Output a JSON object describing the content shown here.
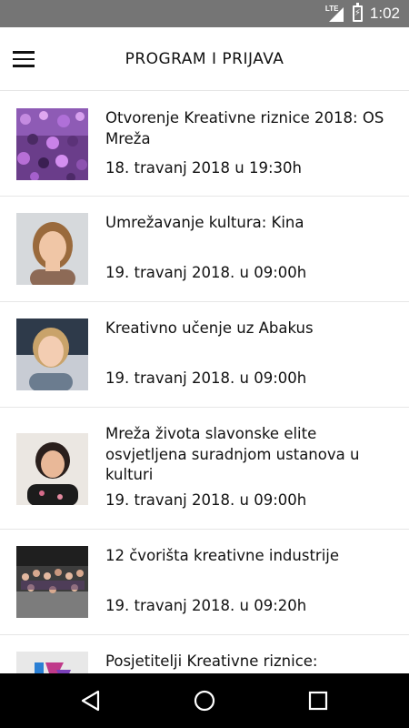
{
  "status_bar": {
    "network_label": "LTE",
    "time": "1:02",
    "icons": [
      "signal-icon",
      "battery-charging-icon"
    ]
  },
  "app_bar": {
    "title": "PROGRAM I PRIJAVA",
    "menu_icon": "hamburger-menu-icon"
  },
  "events": [
    {
      "title": "Otvorenje Kreativne riznice 2018: OS Mreža",
      "date": "18. travanj 2018 u 19:30h",
      "thumbnail": "crowd-purple-photo"
    },
    {
      "title": "Umrežavanje kultura: Kina",
      "date": "19. travanj 2018. u 09:00h",
      "thumbnail": "woman-portrait-photo"
    },
    {
      "title": "Kreativno učenje uz Abakus",
      "date": "19. travanj 2018. u 09:00h",
      "thumbnail": "blonde-woman-portrait-photo"
    },
    {
      "title": "Mreža života slavonske elite osvjetljena suradnjom ustanova u kulturi",
      "date": "19. travanj 2018. u 09:00h",
      "thumbnail": "dark-haired-woman-portrait-photo"
    },
    {
      "title": "12 čvorišta kreativne industrije",
      "date": "19. travanj 2018. u 09:20h",
      "thumbnail": "group-photo"
    },
    {
      "title": "Posjetitelji Kreativne riznice:",
      "date": "",
      "thumbnail": "logo-photo"
    }
  ],
  "nav_bar": {
    "buttons": [
      "back-icon",
      "home-icon",
      "recents-icon"
    ]
  }
}
